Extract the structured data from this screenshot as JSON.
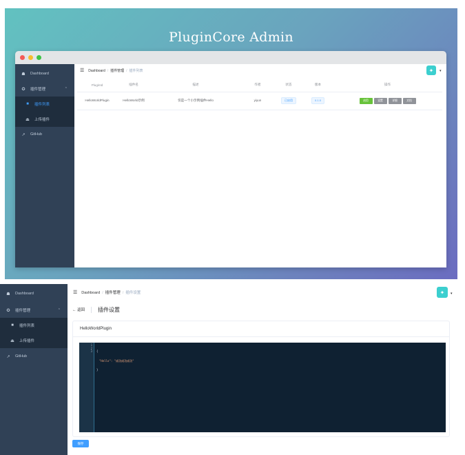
{
  "hero": {
    "title": "PluginCore Admin"
  },
  "sidebar": {
    "items": [
      {
        "label": "Dashboard",
        "icon": "dashboard-icon"
      },
      {
        "label": "插件管理",
        "icon": "gear-icon"
      },
      {
        "label": "插件列表",
        "icon": "list-icon"
      },
      {
        "label": "上传插件",
        "icon": "upload-icon"
      },
      {
        "label": "GitHub",
        "icon": "external-link-icon"
      }
    ]
  },
  "screen1": {
    "breadcrumb": [
      "Dashboard",
      "插件管理",
      "插件列表"
    ],
    "table": {
      "headers": [
        "PluginId",
        "插件名",
        "描述",
        "作者",
        "状态",
        "版本",
        "操作"
      ],
      "rows": [
        {
          "plugin_id": "HelloWorldPlugin",
          "name": "HelloWorld示例",
          "description": "仅是一个小示例插件Hello",
          "author": "yiyun",
          "status": "已启用",
          "version": "0.1.0",
          "actions": [
            "启用",
            "设置",
            "详细",
            "文档"
          ]
        }
      ]
    }
  },
  "screen2": {
    "breadcrumb": [
      "Dashboard",
      "插件管理",
      "插件设置"
    ],
    "back_label": "← 返回",
    "page_title": "插件设置",
    "card_title": "HelloWorldPlugin",
    "editor": {
      "line_numbers": [
        "1",
        "2",
        "3"
      ],
      "lines": [
        "{",
        "\"Hello\": \"成功成功成功\"",
        "}"
      ]
    },
    "save_label": "保存"
  },
  "colors": {
    "sidebar_bg": "#304156",
    "accent": "#409eff",
    "success": "#67c23a",
    "avatar": "#3ccfcf"
  }
}
